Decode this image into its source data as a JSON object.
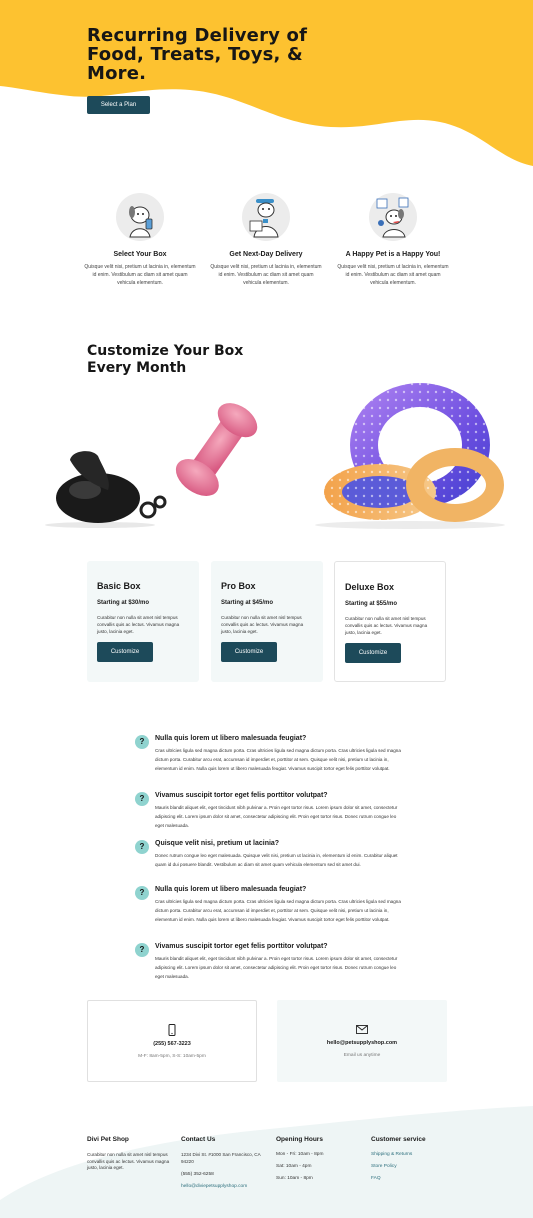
{
  "hero": {
    "title": "Recurring Delivery of Food, Treats, Toys, & More.",
    "button": "Select a Plan",
    "bg_color": "#fdc230"
  },
  "features": [
    {
      "icon": "dog-phone-illustration",
      "title": "Select Your Box",
      "text": "Quisque velit nisi, pretium ut lacinia in, elementum id enim. Vestibulum ac diam sit amet quam vehicula elementum."
    },
    {
      "icon": "dog-delivery-illustration",
      "title": "Get Next-Day Delivery",
      "text": "Quisque velit nisi, pretium ut lacinia in, elementum id enim. Vestibulum ac diam sit amet quam vehicula elementum."
    },
    {
      "icon": "happy-dog-toys-illustration",
      "title": "A Happy Pet is a Happy You!",
      "text": "Quisque velit nisi, pretium ut lacinia in, elementum id enim. Vestibulum ac diam sit amet quam vehicula elementum."
    }
  ],
  "customize": {
    "title": "Customize Your Box Every Month"
  },
  "plans": [
    {
      "name": "Basic Box",
      "price": "Starting at $30/mo",
      "text": "Curabitur non nulla sit amet nisl tempus convallis quis ac lectus. Vivamus magna justo, lacinia eget.",
      "button": "Customize"
    },
    {
      "name": "Pro Box",
      "price": "Starting at $45/mo",
      "text": "Curabitur non nulla sit amet nisl tempus convallis quis ac lectus. Vivamus magna justo, lacinia eget.",
      "button": "Customize"
    },
    {
      "name": "Deluxe Box",
      "price": "Starting at $55/mo",
      "text": "Curabitur non nulla sit amet nisl tempus convallis quis ac lectus. Vivamus magna justo, lacinia eget.",
      "button": "Customize"
    }
  ],
  "faq": [
    {
      "q": "Nulla quis lorem ut libero malesuada feugiat?",
      "a": "Cras ultricies ligula sed magna dictum porta. Cras ultricies ligula sed magna dictum porta. Cras ultricies ligula sed magna dictum porta. Curabitur arcu erat, accumsan id imperdiet et, porttitor at sem. Quisque velit nisi, pretium ut lacinia in, elementum id enim. Nulla quis lorem ut libero malesuada feugiat. Vivamus suscipit tortor eget felis porttitor volutpat."
    },
    {
      "q": "Vivamus suscipit tortor eget felis porttitor volutpat?",
      "a": "Mauris blandit aliquet elit, eget tincidunt nibh pulvinar a. Proin eget tortor risus. Lorem ipsum dolor sit amet, consectetur adipiscing elit. Lorem ipsum dolor sit amet, consectetur adipiscing elit. Proin eget tortor risus. Donec rutrum congue leo eget malesuada."
    },
    {
      "q": "Quisque velit nisi, pretium ut lacinia?",
      "a": "Donec rutrum congue leo eget malesuada. Quisque velit nisi, pretium ut lacinia in, elementum id enim. Curabitur aliquet quam id dui posuere blandit. Vestibulum ac diam sit amet quam vehicula elementum sed sit amet dui."
    },
    {
      "q": "Nulla quis lorem ut libero malesuada feugiat?",
      "a": "Cras ultricies ligula sed magna dictum porta. Cras ultricies ligula sed magna dictum porta. Cras ultricies ligula sed magna dictum porta. Curabitur arcu erat, accumsan id imperdiet et, porttitor at sem. Quisque velit nisi, pretium ut lacinia in, elementum id enim. Nulla quis lorem ut libero malesuada feugiat. Vivamus suscipit tortor eget felis porttitor volutpat."
    },
    {
      "q": "Vivamus suscipit tortor eget felis porttitor volutpat?",
      "a": "Mauris blandit aliquet elit, eget tincidunt nibh pulvinar a. Proin eget tortor risus. Lorem ipsum dolor sit amet, consectetur adipiscing elit. Lorem ipsum dolor sit amet, consectetur adipiscing elit. Proin eget tortor risus. Donec rutrum congue leo eget malesuada."
    }
  ],
  "contact": {
    "phone": {
      "icon": "phone-icon",
      "value": "(255) 567-3223",
      "sub": "M-F: 8am-5pm, S-S: 10am-5pm"
    },
    "email": {
      "icon": "envelope-icon",
      "value": "hello@petsupplyshop.com",
      "sub": "Email us anytime"
    }
  },
  "footer": {
    "brand": {
      "title": "Divi Pet Shop",
      "text": "Curabitur non nulla sit amet nisl tempus convallis quis ac lectus. Vivamus magna justo, lacinia eget."
    },
    "contact": {
      "title": "Contact Us",
      "address": "1234 Divi St. #1000 San Francisco, CA 94220",
      "phone": "(555) 352-6258",
      "email": "hello@diviepetsupplyshop.com"
    },
    "hours": {
      "title": "Opening Hours",
      "lines": [
        "Mon - Fri: 10am - 8pm",
        "Sat: 10am - 4pm",
        "Sun: 10am - 8pm"
      ]
    },
    "service": {
      "title": "Customer service",
      "links": [
        "Shipping & Returns",
        "Store Policy",
        "FAQ"
      ]
    }
  }
}
